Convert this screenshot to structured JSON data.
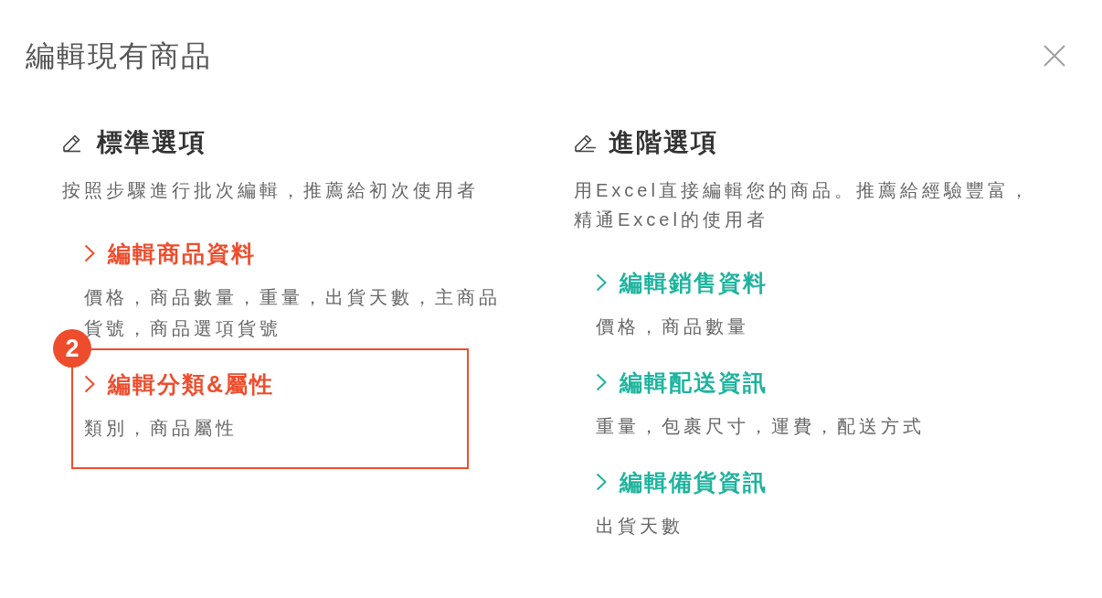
{
  "dialog": {
    "title": "編輯現有商品"
  },
  "sections": [
    {
      "kind": "standard",
      "heading": "標準選項",
      "description": "按照步驟進行批次編輯，推薦給初次使用者",
      "color": "#ee4d2d",
      "items": [
        {
          "title": "編輯商品資料",
          "description": "價格，商品數量，重量，出貨天數，主商品貨號，商品選項貨號",
          "highlighted": false
        },
        {
          "title": "編輯分類&屬性",
          "description": "類別，商品屬性",
          "highlighted": true,
          "badge": "2"
        }
      ]
    },
    {
      "kind": "advanced",
      "heading": "進階選項",
      "description": "用Excel直接編輯您的商品。推薦給經驗豐富，精通Excel的使用者",
      "color": "#1fb39e",
      "items": [
        {
          "title": "編輯銷售資料",
          "description": "價格，商品數量",
          "highlighted": false
        },
        {
          "title": "編輯配送資訊",
          "description": "重量，包裹尺寸，運費，配送方式",
          "highlighted": false
        },
        {
          "title": "編輯備貨資訊",
          "description": "出貨天數",
          "highlighted": false
        }
      ]
    }
  ]
}
